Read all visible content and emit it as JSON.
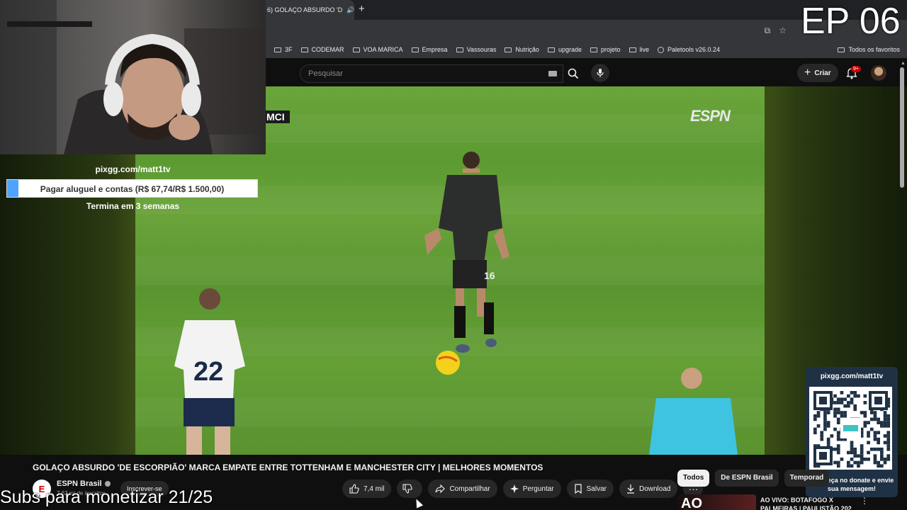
{
  "browser": {
    "tab_title": "6) GOLAÇO ABSURDO 'D",
    "bookmarks": [
      "3F",
      "CODEMAR",
      "VOA MARICA",
      "Empresa",
      "Vassouras",
      "Nutrição",
      "upgrade",
      "projeto",
      "live",
      "Paletools v26.0.24"
    ],
    "all_favorites": "Todos os favoritos"
  },
  "youtube": {
    "search_placeholder": "Pesquisar",
    "create_label": "Criar",
    "notifications_badge": "9+",
    "video_overlay_score": "MCI",
    "broadcaster_logo": "ESPN",
    "video_title": "GOLAÇO ABSURDO 'DE ESCORPIÃO' MARCA EMPATE ENTRE TOTTENHAM E MANCHESTER CITY | MELHORES MOMENTOS",
    "channel": {
      "name": "ESPN Brasil",
      "subscribers": "7,62 mi de inscritos",
      "avatar_letter": "E",
      "subscribe_label": "Inscrever-se"
    },
    "actions": {
      "likes": "7,4 mil",
      "share": "Compartilhar",
      "ask": "Perguntar",
      "save": "Salvar",
      "download": "Download"
    },
    "chips": [
      "Todos",
      "De ESPN Brasil",
      "Temporad"
    ],
    "recommended": {
      "thumb_text": "AO",
      "title": "AO VIVO: BOTAFOGO X PALMEIRAS | PAULISTÃO 202"
    }
  },
  "overlay": {
    "pix_url": "pixgg.com/matt1tv",
    "goal_label": "Pagar aluguel e contas (R$ 67,74/R$ 1.500,00)",
    "goal_progress": 0.045,
    "ends": "Termina em 3 semanas",
    "episode": "EP 06",
    "qr_url": "pixgg.com/matt1tv",
    "qr_message": "Fortaleça no donate e envie sua mensagem!",
    "subs_caption": "Subs para monetizar 21/25"
  },
  "colors": {
    "accent_red": "#cc0000",
    "goal_fill": "#4ea3ff",
    "qr_card": "#1f3144"
  }
}
